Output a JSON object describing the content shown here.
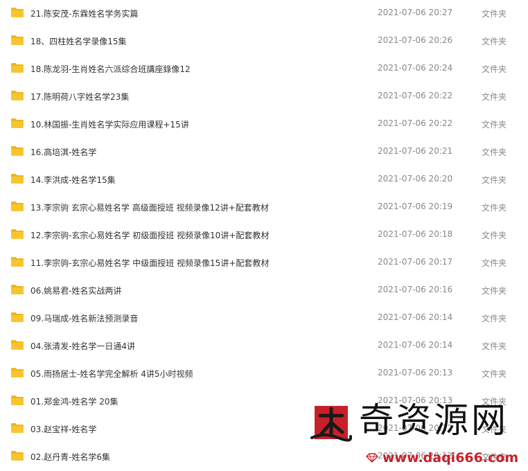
{
  "file_list": {
    "items": [
      {
        "name": "21.陈安茂-东霖姓名学务实篇",
        "date": "2021-07-06 20:27",
        "type": "文件夹"
      },
      {
        "name": "18、四柱姓名学录像15集",
        "date": "2021-07-06 20:26",
        "type": "文件夹"
      },
      {
        "name": "18.陈龙羽-生肖姓名六派综合班講座錄像12",
        "date": "2021-07-06 20:24",
        "type": "文件夹"
      },
      {
        "name": "17.陈明荷八字姓名学23集",
        "date": "2021-07-06 20:22",
        "type": "文件夹"
      },
      {
        "name": "10.林国振-生肖姓名学实际应用课程+15讲",
        "date": "2021-07-06 20:22",
        "type": "文件夹"
      },
      {
        "name": "16.高培淇-姓名学",
        "date": "2021-07-06 20:21",
        "type": "文件夹"
      },
      {
        "name": "14.李洪成-姓名学15集",
        "date": "2021-07-06 20:20",
        "type": "文件夹"
      },
      {
        "name": "13.李宗驹 玄宗心易姓名学 高级面授班 视频录像12讲+配套教材",
        "date": "2021-07-06 20:19",
        "type": "文件夹"
      },
      {
        "name": "12.李宗驹-玄宗心易姓名学 初级面授班 视频录像10讲+配套教材",
        "date": "2021-07-06 20:18",
        "type": "文件夹"
      },
      {
        "name": "11.李宗驹-玄宗心易姓名学 中级面授班 视频录像15讲+配套教材",
        "date": "2021-07-06 20:17",
        "type": "文件夹"
      },
      {
        "name": "06.姚易君-姓名实战两讲",
        "date": "2021-07-06 20:16",
        "type": "文件夹"
      },
      {
        "name": "09.马瑞成-姓名新法预测录音",
        "date": "2021-07-06 20:14",
        "type": "文件夹"
      },
      {
        "name": "04.张清发-姓名学一日通4讲",
        "date": "2021-07-06 20:14",
        "type": "文件夹"
      },
      {
        "name": "05.雨扬居士-姓名学完全解析 4讲5小时视频",
        "date": "2021-07-06 20:13",
        "type": "文件夹"
      },
      {
        "name": "01.郑金鸿-姓名学 20集",
        "date": "2021-07-06 20:13",
        "type": "文件夹"
      },
      {
        "name": "03.赵宝祥-姓名学",
        "date": "2021-07-06 20:12",
        "type": "文件夹"
      },
      {
        "name": "02.赵丹青-姓名学6集",
        "date": "2021-07-06 20:12",
        "type": "文件夹"
      }
    ]
  },
  "icons": {
    "folder": "folder-icon",
    "logo": "daqi-logo-icon",
    "gem": "gem-icon"
  },
  "colors": {
    "folder": "#f7c62f",
    "folder_tab": "#f0b41d",
    "name_text": "#333333",
    "meta_text": "#888888",
    "watermark_red": "#c8202a"
  },
  "watermark": {
    "title": "奇资源网",
    "url": "www.daqi666.com"
  }
}
